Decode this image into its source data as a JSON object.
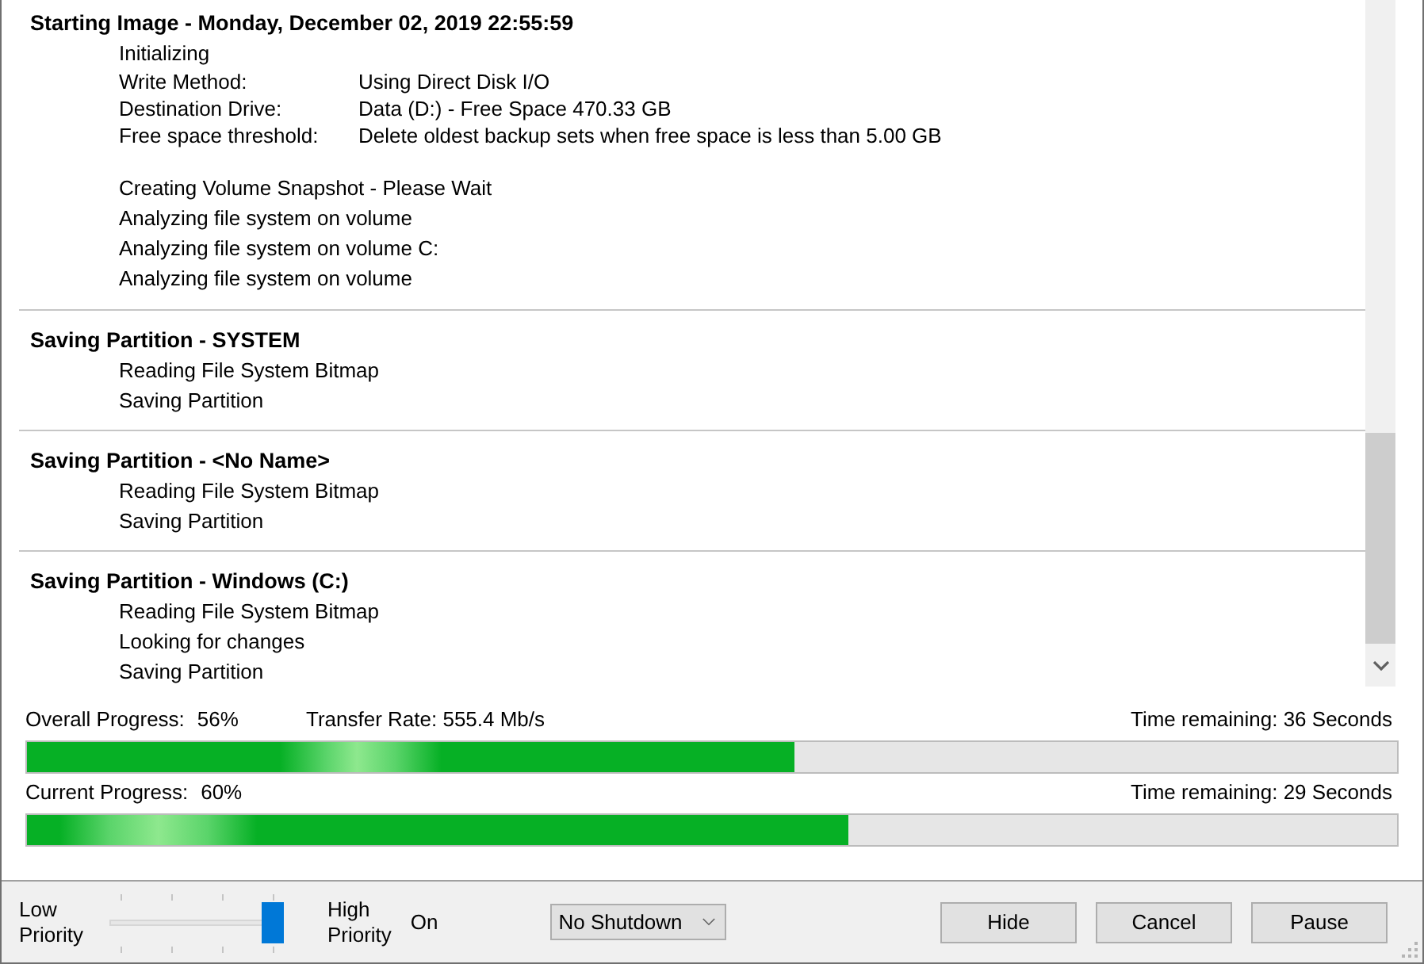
{
  "log": {
    "sections": [
      {
        "title": "Starting Image - Monday, December 02, 2019 22:55:59",
        "groups": [
          [
            {
              "kind": "text",
              "text": "Initializing"
            },
            {
              "kind": "field",
              "label": "Write Method:",
              "value": "Using Direct Disk I/O"
            },
            {
              "kind": "field",
              "label": "Destination Drive:",
              "value": "Data (D:) - Free Space 470.33 GB"
            },
            {
              "kind": "field",
              "label": "Free space threshold:",
              "value": "Delete oldest backup sets when free space is less than 5.00 GB"
            }
          ],
          [
            {
              "kind": "text",
              "text": "Creating Volume Snapshot - Please Wait"
            },
            {
              "kind": "text",
              "text": "Analyzing file system on volume"
            },
            {
              "kind": "text",
              "text": "Analyzing file system on volume C:"
            },
            {
              "kind": "text",
              "text": "Analyzing file system on volume"
            }
          ]
        ]
      },
      {
        "title": "Saving Partition - SYSTEM",
        "groups": [
          [
            {
              "kind": "text",
              "text": "Reading File System Bitmap"
            },
            {
              "kind": "text",
              "text": "Saving Partition"
            }
          ]
        ]
      },
      {
        "title": "Saving Partition - <No Name>",
        "groups": [
          [
            {
              "kind": "text",
              "text": "Reading File System Bitmap"
            },
            {
              "kind": "text",
              "text": "Saving Partition"
            }
          ]
        ]
      },
      {
        "title": "Saving Partition - Windows (C:)",
        "groups": [
          [
            {
              "kind": "text",
              "text": "Reading File System Bitmap"
            },
            {
              "kind": "text",
              "text": "Looking for changes"
            },
            {
              "kind": "text",
              "text": "Saving Partition"
            }
          ]
        ]
      }
    ]
  },
  "progress": [
    {
      "label": "Overall Progress:",
      "percent": "56%",
      "transfer_rate": "Transfer Rate: 555.4 Mb/s",
      "time_remaining": "Time remaining: 36 Seconds",
      "level": 0.56
    },
    {
      "label": "Current Progress:",
      "percent": "60%",
      "time_remaining": "Time remaining: 29 Seconds",
      "level": 0.6
    }
  ],
  "controls": {
    "priority": {
      "low_label": "Low Priority",
      "high_label": "High Priority",
      "level": 1
    },
    "status": "On",
    "shutdown": {
      "value": "No Shutdown"
    },
    "buttons": [
      {
        "label": "Hide"
      },
      {
        "label": "Cancel"
      },
      {
        "label": "Pause"
      }
    ]
  }
}
